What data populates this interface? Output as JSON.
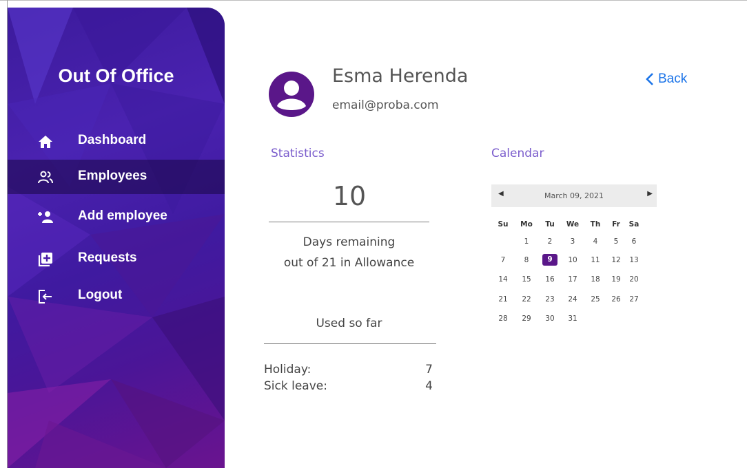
{
  "app": {
    "title": "Out Of Office"
  },
  "sidebar": {
    "items": [
      {
        "label": "Dashboard",
        "icon": "home-icon",
        "active": false
      },
      {
        "label": "Employees",
        "icon": "people-icon",
        "active": true
      },
      {
        "label": "Add employee",
        "icon": "add-person-icon",
        "active": false
      },
      {
        "label": "Requests",
        "icon": "add-box-icon",
        "active": false
      },
      {
        "label": "Logout",
        "icon": "logout-icon",
        "active": false
      }
    ]
  },
  "profile": {
    "name": "Esma Herenda",
    "email": "email@proba.com",
    "avatar_icon": "account-circle-icon"
  },
  "back": {
    "label": "Back"
  },
  "statistics": {
    "title": "Statistics",
    "days_remaining": "10",
    "remaining_label": "Days remaining",
    "allowance_label": "out of 21 in Allowance",
    "used_title": "Used so far",
    "used": [
      {
        "label": "Holiday:",
        "value": "7"
      },
      {
        "label": "Sick leave:",
        "value": "4"
      }
    ]
  },
  "calendar": {
    "title": "Calendar",
    "header": "March 09, 2021",
    "weekdays": [
      "Su",
      "Mo",
      "Tu",
      "We",
      "Th",
      "Fr",
      "Sa"
    ],
    "weeks": [
      [
        "",
        "1",
        "2",
        "3",
        "4",
        "5",
        "6"
      ],
      [
        "7",
        "8",
        "9",
        "10",
        "11",
        "12",
        "13"
      ],
      [
        "14",
        "15",
        "16",
        "17",
        "18",
        "19",
        "20"
      ],
      [
        "21",
        "22",
        "23",
        "24",
        "25",
        "26",
        "27"
      ],
      [
        "28",
        "29",
        "30",
        "31",
        "",
        "",
        ""
      ]
    ],
    "selected": "9"
  },
  "colors": {
    "accent": "#5a1789",
    "section_title": "#7a5ccc",
    "link": "#1a73e8",
    "sidebar": "#4a22b0"
  }
}
